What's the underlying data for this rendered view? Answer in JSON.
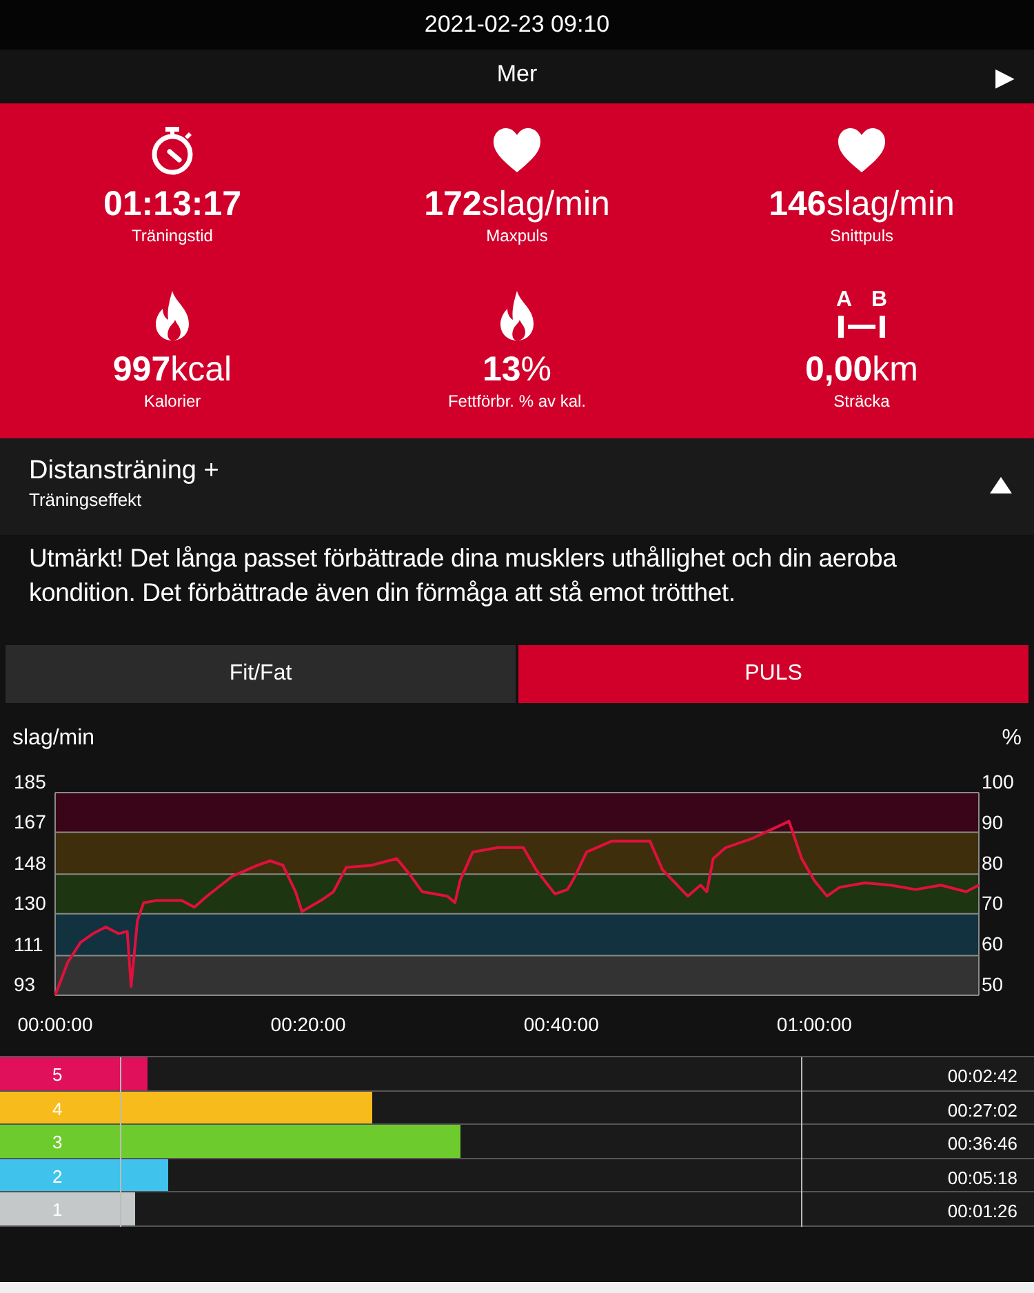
{
  "header": {
    "datetime": "2021-02-23 09:10"
  },
  "more_bar": {
    "label": "Mer",
    "arrow": "▶"
  },
  "stats": [
    {
      "kind": "stopwatch",
      "value": "**01:13:17**",
      "label": "Träningstid"
    },
    {
      "kind": "heart",
      "value": "**172**slag/min",
      "label": "Maxpuls"
    },
    {
      "kind": "heart",
      "value": "**146**slag/min",
      "label": "Snittpuls"
    },
    {
      "kind": "flame",
      "value": "**997**kcal",
      "label": "Kalorier"
    },
    {
      "kind": "flame",
      "value": "**13**%",
      "label": "Fettförbr. % av kal."
    },
    {
      "kind": "distance",
      "markers": [
        "A",
        "B"
      ],
      "value": "**0,00**km",
      "label": "Sträcka"
    }
  ],
  "effect": {
    "title": "Distansträning +",
    "subtitle": "Träningseffekt",
    "expanded": true,
    "text": "Utmärkt! Det långa passet förbättrade dina musklers uthållighet och din aeroba kondition. Det förbättrade även din förmåga att stå emot trötthet."
  },
  "tabs": [
    {
      "label": "Fit/Fat",
      "selected": false
    },
    {
      "label": "PULS",
      "selected": true
    }
  ],
  "chart": {
    "right_label": "%",
    "right_ticks": [
      "100",
      "90",
      "80",
      "70",
      "60",
      "50"
    ],
    "chart_data": {
      "type": "line",
      "ylabel": "slag/min",
      "xlim": [
        0,
        73
      ],
      "ylim": [
        93,
        185
      ],
      "grid": true,
      "bands": [
        {
          "axis": "y",
          "from": 167,
          "to": 185,
          "color": "#3a0519"
        },
        {
          "axis": "y",
          "from": 148,
          "to": 167,
          "color": "#3f2e0b"
        },
        {
          "axis": "y",
          "from": 130,
          "to": 148,
          "color": "#1d3510"
        },
        {
          "axis": "y",
          "from": 111,
          "to": 130,
          "color": "#12323f"
        },
        {
          "axis": "y",
          "from": 93,
          "to": 111,
          "color": "#333333"
        }
      ],
      "yticks": [
        185,
        167,
        148,
        130,
        111,
        93
      ],
      "xticks": [
        {
          "value": 0,
          "label": "00:00:00"
        },
        {
          "value": 20,
          "label": "00:20:00"
        },
        {
          "value": 40,
          "label": "00:40:00"
        },
        {
          "value": 60,
          "label": "01:00:00"
        }
      ],
      "x": [
        0,
        1,
        2,
        3,
        4,
        5,
        5.7,
        6,
        6.5,
        7,
        8,
        10,
        11,
        12,
        14,
        16,
        17,
        18,
        19,
        19.5,
        21,
        22,
        23,
        25,
        27,
        28,
        29,
        31,
        31.6,
        32,
        33,
        35,
        37,
        38,
        39.5,
        40.5,
        41,
        42,
        44,
        47,
        48,
        49.5,
        50,
        51,
        51.5,
        52,
        53,
        55,
        58,
        59,
        60,
        61,
        62,
        64,
        66,
        68,
        70,
        72,
        73
      ],
      "series": [
        {
          "color": "#e0103c",
          "values": [
            93,
            108,
            117,
            121,
            124,
            121,
            122,
            97,
            127,
            135,
            136,
            136,
            133,
            138,
            147,
            152,
            154,
            152,
            140,
            131,
            136,
            140,
            151,
            152,
            155,
            148,
            140,
            138,
            135,
            145,
            158,
            160,
            160,
            150,
            139,
            141,
            146,
            158,
            163,
            163,
            150,
            141,
            138,
            143,
            140,
            155,
            160,
            164,
            172,
            155,
            145,
            138,
            142,
            144,
            143,
            141,
            143,
            140,
            143
          ]
        }
      ]
    }
  },
  "zones": [
    {
      "label": "5",
      "color": "#e0105a",
      "level": 0.143,
      "time": "00:02:42"
    },
    {
      "label": "4",
      "color": "#f7bc1c",
      "level": 0.36,
      "time": "00:27:02"
    },
    {
      "label": "3",
      "color": "#6ecb2d",
      "level": 0.445,
      "time": "00:36:46"
    },
    {
      "label": "2",
      "color": "#3fc3ec",
      "level": 0.163,
      "time": "00:05:18"
    },
    {
      "label": "1",
      "color": "#c4c8c8",
      "level": 0.131,
      "time": "00:01:26"
    }
  ]
}
